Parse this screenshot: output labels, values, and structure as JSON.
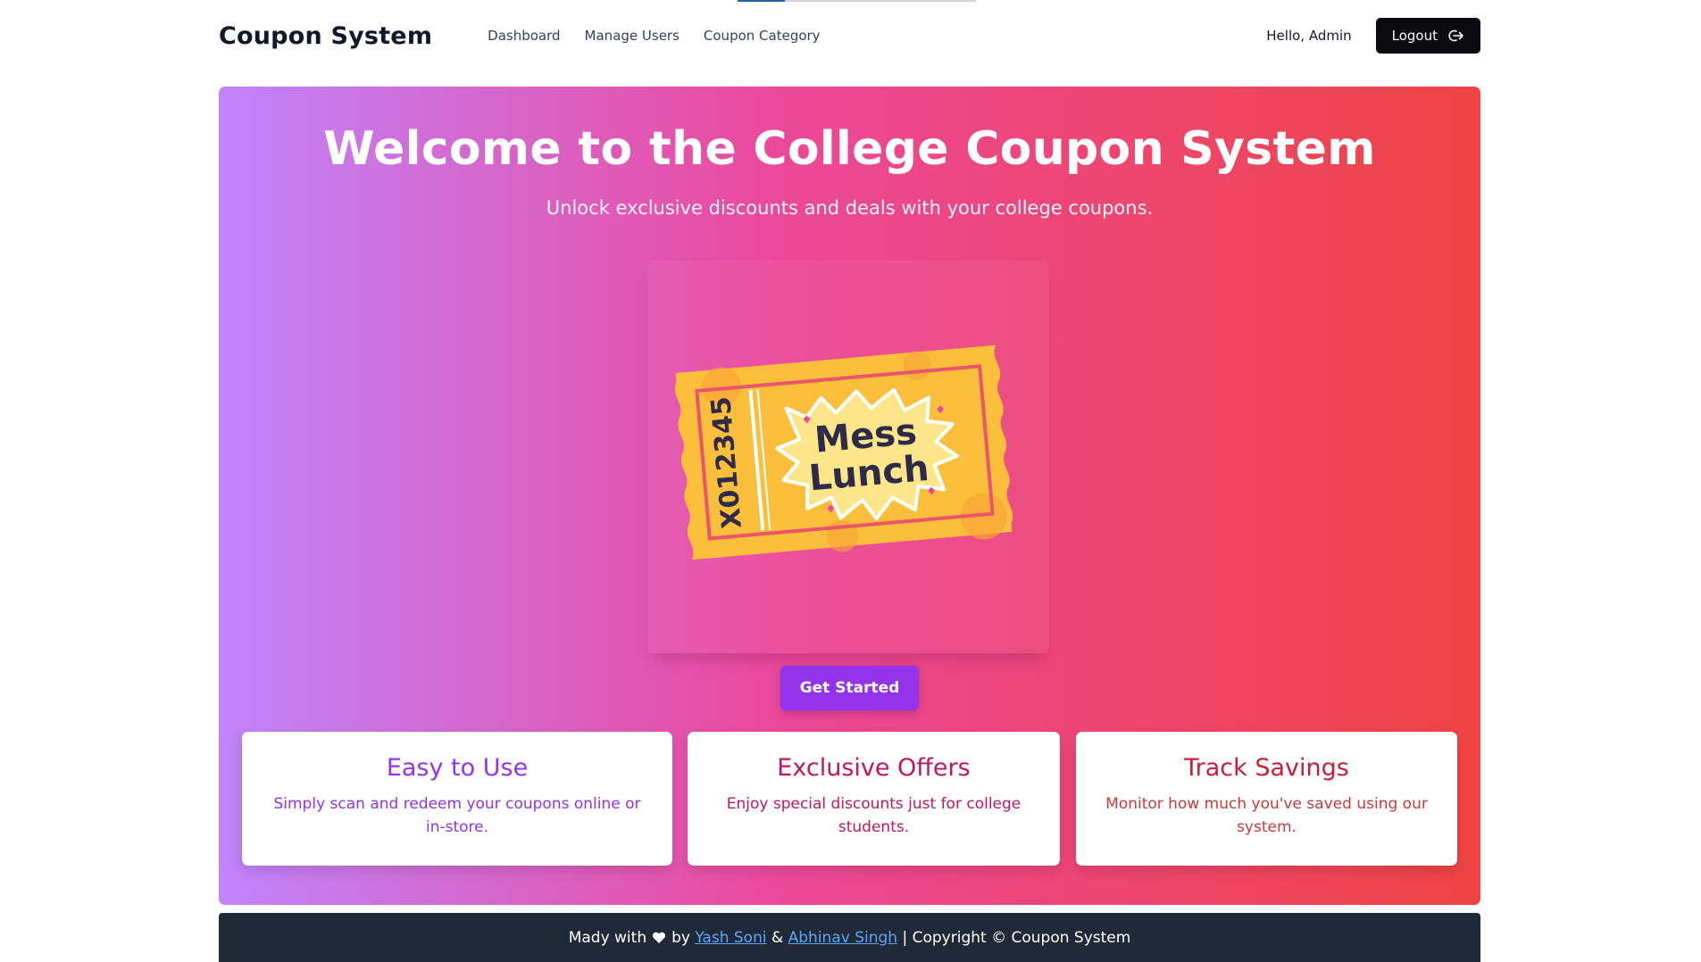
{
  "page": {
    "loading_progress": 0.2
  },
  "navbar": {
    "brand": "Coupon System",
    "links": [
      "Dashboard",
      "Manage Users",
      "Coupon Category"
    ],
    "greeting": "Hello, Admin",
    "logout_label": "Logout",
    "logout_icon": "logout-icon"
  },
  "hero": {
    "title": "Welcome to the College Coupon System",
    "subtitle": "Unlock exclusive discounts and deals with your college coupons.",
    "coupon_image": {
      "serial": "X012345",
      "line1": "Mess",
      "line2": "Lunch"
    },
    "cta_label": "Get Started",
    "gradient": [
      "#c084fc",
      "#ec4899",
      "#ef4444"
    ]
  },
  "features": [
    {
      "title": "Easy to Use",
      "desc": "Simply scan and redeem your coupons online or in-store.",
      "color": "#9333ea"
    },
    {
      "title": "Exclusive Offers",
      "desc": "Enjoy special discounts just for college students.",
      "color": "#be185d"
    },
    {
      "title": "Track Savings",
      "desc": "Monitor how much you've saved using our system.",
      "color": "#c81e3a"
    }
  ],
  "footer": {
    "prefix": "Mady with",
    "heart_icon": "heart-icon",
    "by": "by",
    "author1": "Yash Soni",
    "amp": "&",
    "author2": "Abhinav Singh",
    "suffix": "| Copyright © Coupon System",
    "bg_color": "#1f2937",
    "link_color": "#60a5fa"
  }
}
